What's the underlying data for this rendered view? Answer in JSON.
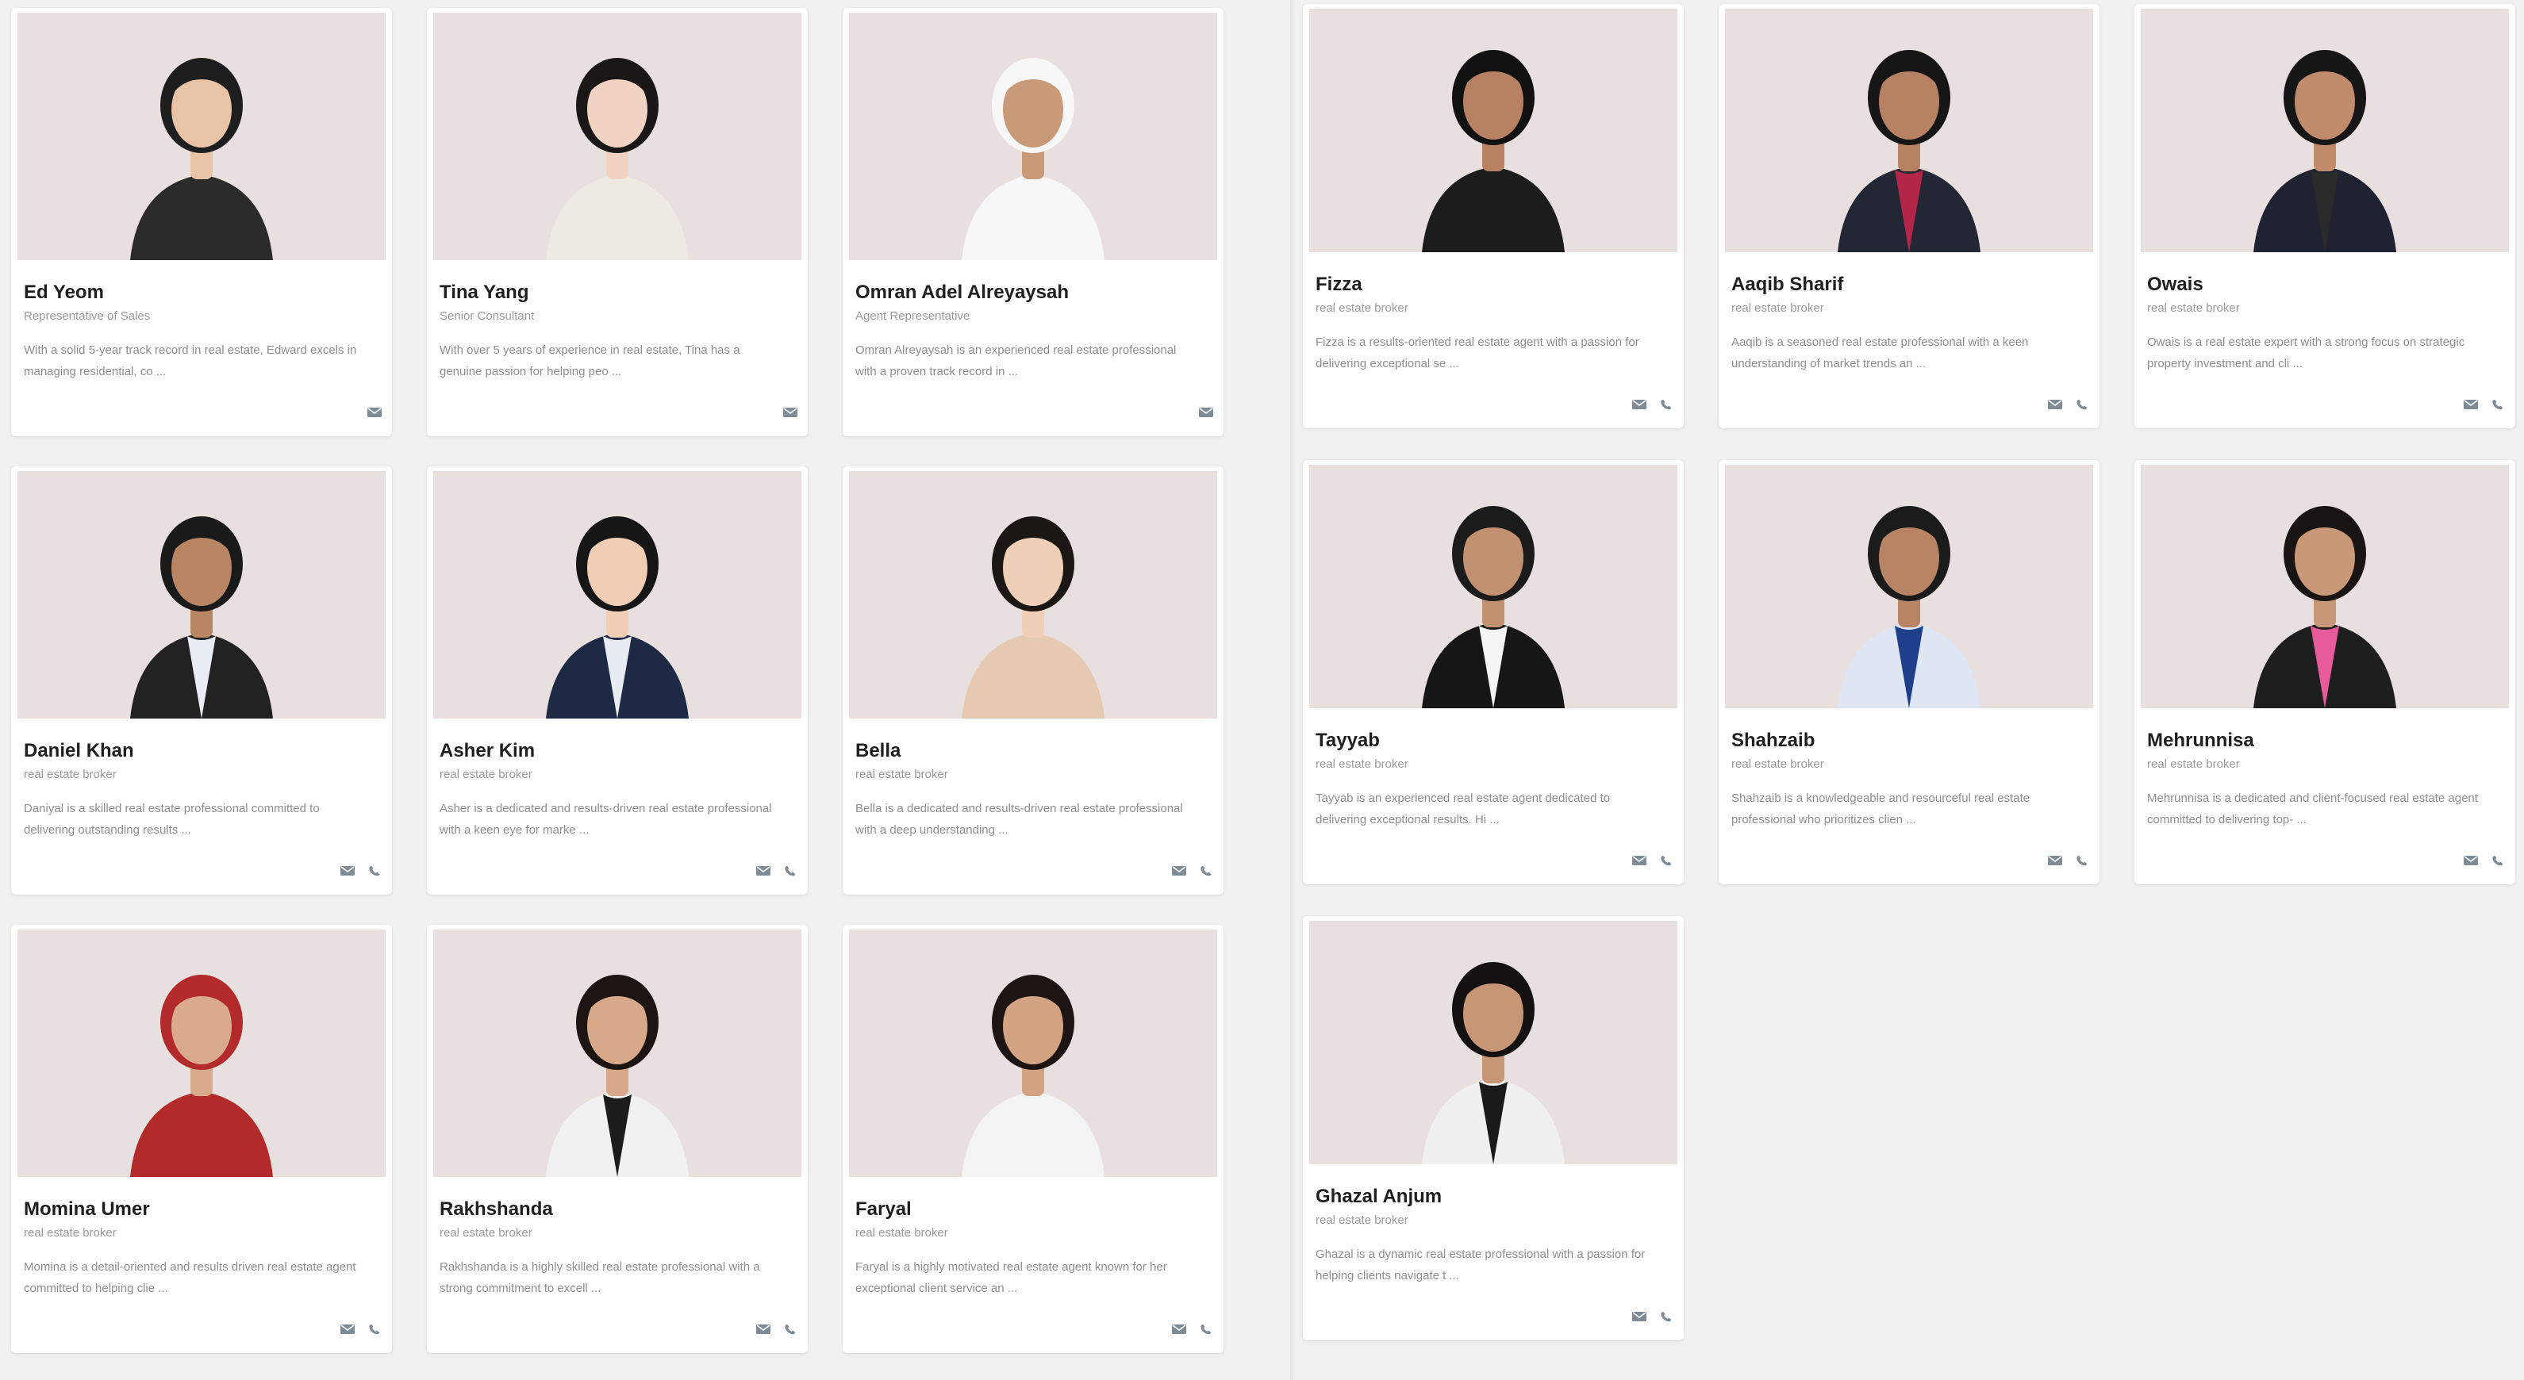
{
  "colors": {
    "page_bg": "#f2f1f1",
    "photo_bg": "#e8e0df",
    "icon": "#7f8c96"
  },
  "left_cards": [
    {
      "name": "Ed Yeom",
      "role": "Representative of Sales",
      "desc": "With a solid 5-year track record in real estate, Edward excels in managing residential, co ...",
      "icons": [
        "mail-icon"
      ],
      "avatar": {
        "skin": "#e9c3a6",
        "hair": "#1e1e1e",
        "outfit": "#2b2b2b",
        "accent": "#2b2b2b"
      }
    },
    {
      "name": "Tina Yang",
      "role": "Senior Consultant",
      "desc": "With over 5 years of experience in real estate, Tina has a genuine passion for helping peo ...",
      "icons": [
        "mail-icon"
      ],
      "avatar": {
        "skin": "#f1d3c4",
        "hair": "#1b1716",
        "outfit": "#efe9e3",
        "accent": "#efe9e3"
      }
    },
    {
      "name": "Omran Adel Alreyaysah",
      "role": "Agent Representative",
      "desc": "Omran Alreyaysah is an experienced real estate professional with a proven track record in ...",
      "icons": [
        "mail-icon"
      ],
      "avatar": {
        "skin": "#c99a78",
        "hair": "#f7f7f7",
        "outfit": "#f7f7f7",
        "accent": "#f7f7f7"
      }
    },
    {
      "name": "Daniel Khan",
      "role": "real estate broker",
      "desc": "Daniyal is a skilled real estate professional committed to delivering outstanding results ...",
      "icons": [
        "mail-icon",
        "phone-icon"
      ],
      "avatar": {
        "skin": "#b98663",
        "hair": "#1a1a1a",
        "outfit": "#222222",
        "accent": "#e9eef4"
      }
    },
    {
      "name": "Asher Kim",
      "role": "real estate broker",
      "desc": "Asher is a dedicated and results-driven real estate professional with a keen eye for marke ...",
      "icons": [
        "mail-icon",
        "phone-icon"
      ],
      "avatar": {
        "skin": "#f0cdb5",
        "hair": "#161616",
        "outfit": "#1e2a44",
        "accent": "#e8edf3"
      }
    },
    {
      "name": "Bella",
      "role": "real estate broker",
      "desc": "Bella is a dedicated and results-driven real estate professional with a deep understanding ...",
      "icons": [
        "mail-icon",
        "phone-icon"
      ],
      "avatar": {
        "skin": "#efcfb8",
        "hair": "#1d1714",
        "outfit": "#e6c9b2",
        "accent": "#e6c9b2"
      }
    },
    {
      "name": "Momina Umer",
      "role": "real estate broker",
      "desc": "Momina is a detail-oriented and results driven real estate agent committed to helping clie ...",
      "icons": [
        "mail-icon",
        "phone-icon"
      ],
      "avatar": {
        "skin": "#d9ab8c",
        "hair": "#b22a2a",
        "outfit": "#b22a2a",
        "accent": "#b22a2a"
      }
    },
    {
      "name": "Rakhshanda",
      "role": "real estate broker",
      "desc": "Rakhshanda is a highly skilled real estate professional with a strong commitment to excell ...",
      "icons": [
        "mail-icon",
        "phone-icon"
      ],
      "avatar": {
        "skin": "#d7a98a",
        "hair": "#1c1512",
        "outfit": "#f1f1f1",
        "accent": "#1c1c1c"
      }
    },
    {
      "name": "Faryal",
      "role": "real estate broker",
      "desc": "Faryal is a highly motivated real estate agent known for her exceptional client service an ...",
      "icons": [
        "mail-icon",
        "phone-icon"
      ],
      "avatar": {
        "skin": "#d3a383",
        "hair": "#1c1512",
        "outfit": "#f3f3f3",
        "accent": "#f3f3f3"
      }
    }
  ],
  "right_cards": [
    {
      "name": "Fizza",
      "role": "real estate broker",
      "desc": "Fizza is a results-oriented real estate agent with a passion for delivering exceptional se ...",
      "icons": [
        "mail-icon",
        "phone-icon"
      ],
      "avatar": {
        "skin": "#b98163",
        "hair": "#111111",
        "outfit": "#1c1c1c",
        "accent": "#1c1c1c"
      }
    },
    {
      "name": "Aaqib Sharif",
      "role": "real estate broker",
      "desc": "Aaqib is a seasoned real estate professional with a keen understanding of market trends an ...",
      "icons": [
        "mail-icon",
        "phone-icon"
      ],
      "avatar": {
        "skin": "#b78263",
        "hair": "#161616",
        "outfit": "#232734",
        "accent": "#b3264a"
      }
    },
    {
      "name": "Owais",
      "role": "real estate broker",
      "desc": "Owais is a real estate expert with a strong focus on strategic property investment and cli ...",
      "icons": [
        "mail-icon",
        "phone-icon"
      ],
      "avatar": {
        "skin": "#c08c6c",
        "hair": "#161616",
        "outfit": "#1f2230",
        "accent": "#2a2a2a"
      }
    },
    {
      "name": "Tayyab",
      "role": "real estate broker",
      "desc": "Tayyab is an experienced real estate agent dedicated to delivering exceptional results. Hi ...",
      "icons": [
        "mail-icon",
        "phone-icon"
      ],
      "avatar": {
        "skin": "#c29172",
        "hair": "#1b1b1b",
        "outfit": "#161616",
        "accent": "#f5f5f5"
      }
    },
    {
      "name": "Shahzaib",
      "role": "real estate broker",
      "desc": "Shahzaib is a knowledgeable and resourceful real estate professional who prioritizes clien ...",
      "icons": [
        "mail-icon",
        "phone-icon"
      ],
      "avatar": {
        "skin": "#b88466",
        "hair": "#1b1b1b",
        "outfit": "#dde6f2",
        "accent": "#1f3f8a"
      }
    },
    {
      "name": "Mehrunnisa",
      "role": "real estate broker",
      "desc": "Mehrunnisa is a dedicated and client-focused real estate agent committed to delivering top- ...",
      "icons": [
        "mail-icon",
        "phone-icon"
      ],
      "avatar": {
        "skin": "#c99878",
        "hair": "#1a1412",
        "outfit": "#1e1e1e",
        "accent": "#e75b9a"
      }
    },
    {
      "name": "Ghazal Anjum",
      "role": "real estate broker",
      "desc": "Ghazal is a dynamic real estate professional with a passion for helping clients navigate t ...",
      "icons": [
        "mail-icon",
        "phone-icon"
      ],
      "avatar": {
        "skin": "#c79676",
        "hair": "#141111",
        "outfit": "#f0f0f0",
        "accent": "#1a1a1a"
      }
    }
  ]
}
